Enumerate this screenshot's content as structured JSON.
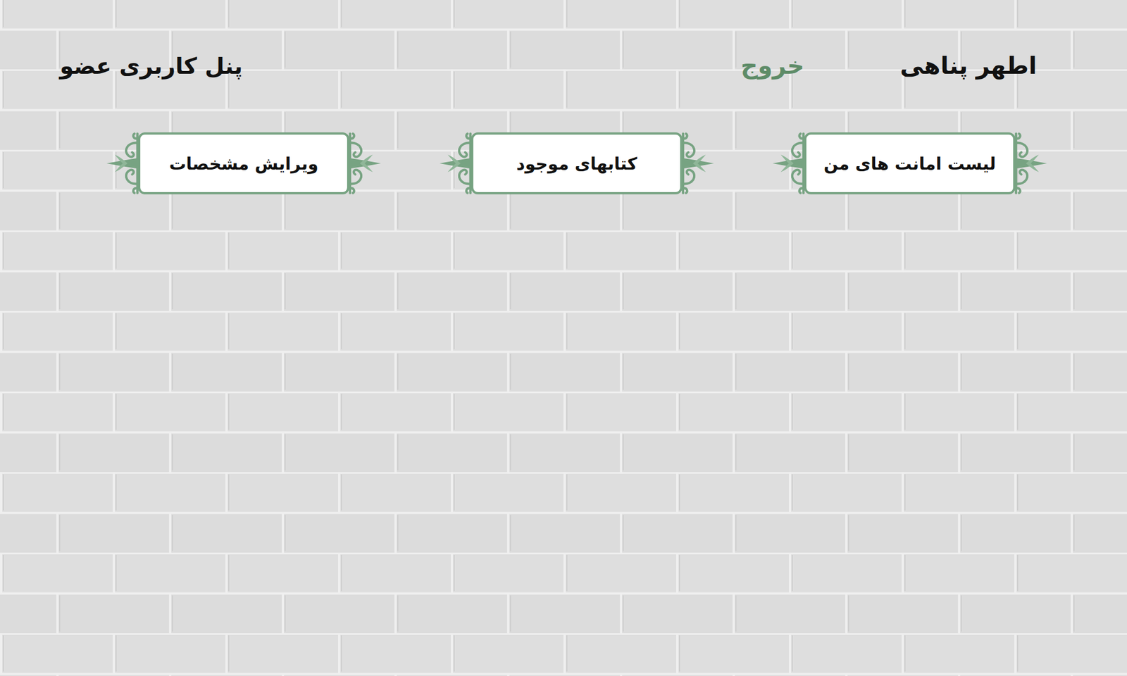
{
  "header": {
    "user_name": "اطهر پناهی",
    "logout": "خروج",
    "panel_title": "پنل کاربری عضو"
  },
  "menu": [
    {
      "label": "لیست امانت های من"
    },
    {
      "label": "کتابهای موجود"
    },
    {
      "label": "ویرایش مشخصات"
    }
  ]
}
